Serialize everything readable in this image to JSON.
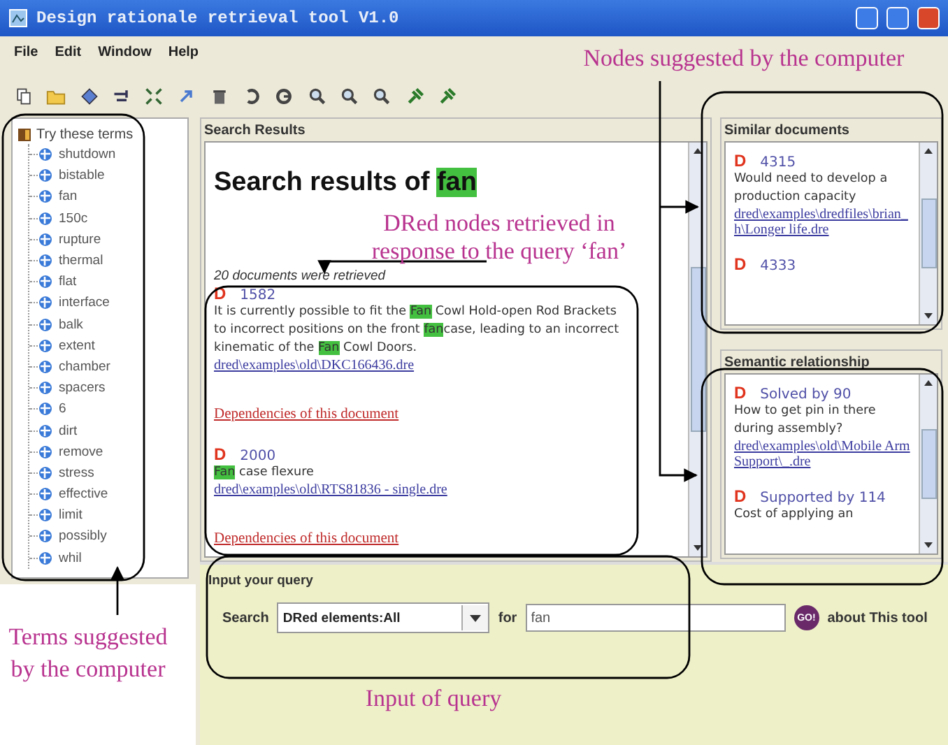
{
  "window": {
    "title": "Design rationale retrieval tool V1.0"
  },
  "menu": [
    "File",
    "Edit",
    "Window",
    "Help"
  ],
  "terms": {
    "root": "Try these terms",
    "children": [
      {
        "label": "shutdown"
      },
      {
        "label": "bistable"
      },
      {
        "label": "fan"
      },
      {
        "label": "150c"
      },
      {
        "label": "rupture"
      },
      {
        "label": "thermal"
      },
      {
        "label": "flat"
      },
      {
        "label": "interface"
      },
      {
        "label": "balk"
      },
      {
        "label": "extent"
      },
      {
        "label": "chamber"
      },
      {
        "label": "spacers"
      },
      {
        "label": "6"
      },
      {
        "label": "dirt"
      },
      {
        "label": "remove"
      },
      {
        "label": "stress"
      },
      {
        "label": "effective"
      },
      {
        "label": "limit"
      },
      {
        "label": "possibly"
      },
      {
        "label": "whil"
      }
    ]
  },
  "search_results": {
    "title": "Search Results",
    "heading": [
      {
        "text": "Search results of ",
        "highlight": false
      },
      {
        "text": "fan",
        "highlight": true
      }
    ],
    "count": "20 documents were retrieved",
    "results": [
      {
        "marker": "D",
        "id": "1582",
        "text": [
          {
            "text": "It is currently possible to fit the ",
            "highlight": false
          },
          {
            "text": "Fan",
            "highlight": true
          },
          {
            "text": " Cowl Hold-open Rod Brackets to incorrect positions on the front ",
            "highlight": false
          },
          {
            "text": "fan",
            "highlight": true
          },
          {
            "text": "case, leading to an incorrect kinematic of the ",
            "highlight": false
          },
          {
            "text": "Fan",
            "highlight": true
          },
          {
            "text": " Cowl Doors.",
            "highlight": false
          }
        ],
        "link": "dred\\examples\\old\\DKC166436.dre",
        "dependencies": "Dependencies of this document"
      },
      {
        "marker": "D",
        "id": "2000",
        "text": [
          {
            "text": "Fan",
            "highlight": true
          },
          {
            "text": " case flexure",
            "highlight": false
          }
        ],
        "link": "dred\\examples\\old\\RTS81836 - single.dre",
        "dependencies": "Dependencies of this document"
      }
    ]
  },
  "similar_documents": {
    "title": "Similar documents",
    "items": [
      {
        "marker": "D",
        "id": "4315",
        "text": "Would need to develop a production capacity",
        "link": "dred\\examples\\dredfiles\\brian_h\\Longer life.dre"
      },
      {
        "marker": "D",
        "id": "4333"
      }
    ]
  },
  "semantic_relationship": {
    "title": "Semantic relationship",
    "items": [
      {
        "marker": "D",
        "id": "Solved by 90",
        "text": "How to get pin in there during assembly?",
        "link": "dred\\examples\\old\\Mobile Arm Support\\_.dre"
      },
      {
        "marker": "D",
        "id": "Supported by 114",
        "text": "Cost of applying an"
      }
    ]
  },
  "query": {
    "title": "Input your query",
    "search_label": "Search",
    "scope": "DRed elements:All",
    "for_label": "for",
    "value": "fan",
    "go": "GO!",
    "about": "about This tool"
  },
  "annotations": [
    {
      "text": "Nodes suggested by the computer"
    },
    {
      "text": "DRed nodes retrieved in response to the query ‘fan’"
    },
    {
      "text": "Terms suggested by the computer"
    },
    {
      "text": "Input of query"
    }
  ]
}
